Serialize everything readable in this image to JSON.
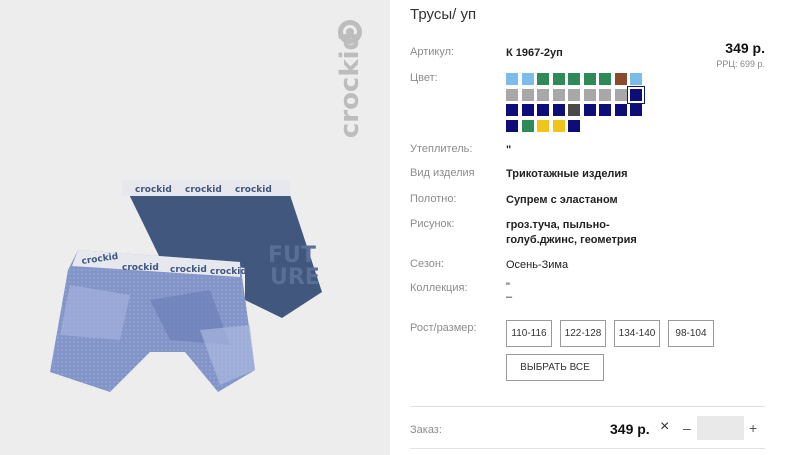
{
  "product": {
    "brand_logo_text": "crockid",
    "title": "Трусы/ уп",
    "price": "349 р.",
    "rrp": "РРЦ: 699 р."
  },
  "specs": {
    "article_label": "Артикул:",
    "article_value": "К 1967-2уп",
    "color_label": "Цвет:",
    "insulation_label": "Утеплитель:",
    "insulation_value": "\"",
    "type_label": "Вид изделия",
    "type_value": "Трикотажные изделия",
    "fabric_label": "Полотно:",
    "fabric_value": "Супрем с эластаном",
    "pattern_label": "Рисунок:",
    "pattern_value": "гроз.туча, пыльно-голуб.джинс, геометрия",
    "season_label": "Сезон:",
    "season_value": "Осень-Зима",
    "collection_label": "Коллекция:",
    "collection_value_1": "\"",
    "collection_value_2": "–"
  },
  "colors": [
    "#7bbde8",
    "#7bbde8",
    "#2e8b57",
    "#2e8b57",
    "#2e8b57",
    "#2e8b57",
    "#2e8b57",
    "#8b4a2a",
    "#7bbde8",
    "#a8a8a8",
    "#a8a8a8",
    "#a8a8a8",
    "#a8a8a8",
    "#a8a8a8",
    "#a8a8a8",
    "#a8a8a8",
    "#a8a8a8",
    "#0d0d7a",
    "#0d0d7a",
    "#0d0d7a",
    "#0d0d7a",
    "#0d0d7a",
    "#4a4a4a",
    "#0d0d7a",
    "#0d0d7a",
    "#0d0d7a",
    "#0d0d7a",
    "#0d0d7a",
    "#2e8b57",
    "#f0c419",
    "#f0c419",
    "#0d0d7a"
  ],
  "sizes": {
    "label": "Рост/размер:",
    "options": [
      "110-116",
      "122-128",
      "134-140",
      "98-104"
    ],
    "select_all": "ВЫБРАТЬ ВСЕ"
  },
  "order": {
    "label": "Заказ:",
    "price": "349 р.",
    "remove_icon": "×",
    "minus": "–",
    "plus": "+",
    "quantity": ""
  }
}
